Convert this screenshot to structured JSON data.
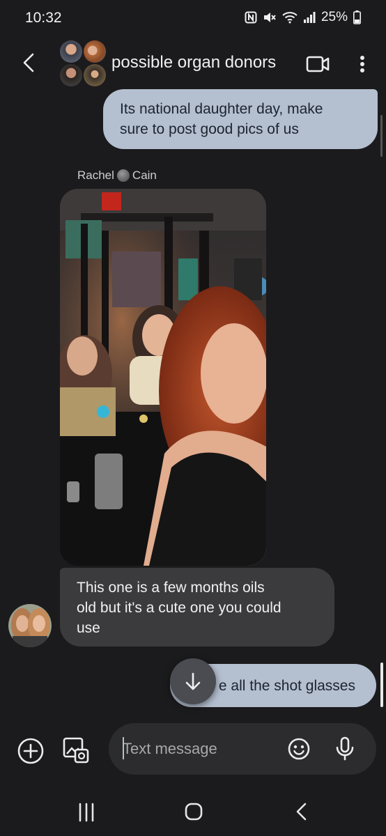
{
  "status_bar": {
    "time": "10:32",
    "battery": "25%",
    "icons": [
      "nfc-icon",
      "mute-icon",
      "wifi-icon",
      "signal-icon",
      "battery-icon"
    ]
  },
  "header": {
    "title": "possible organ donors",
    "back_icon": "back-arrow-icon",
    "video_icon": "video-call-icon",
    "more_icon": "more-vert-icon"
  },
  "messages": [
    {
      "direction": "outgoing",
      "text_lines": [
        "Its national daughter day, make",
        "sure to post good pics of us"
      ]
    },
    {
      "direction": "incoming",
      "sender": {
        "first": "Rachel",
        "last": "Cain"
      },
      "type": "image"
    },
    {
      "direction": "incoming",
      "text_lines": [
        "This one is a few months oils",
        "old but it's a cute one you could",
        "use"
      ]
    },
    {
      "direction": "outgoing",
      "text": "e all the shot glasses"
    }
  ],
  "composer": {
    "placeholder": "Text message",
    "add_icon": "add-circle-icon",
    "gallery_icon": "gallery-icon",
    "emoji_icon": "emoji-icon",
    "mic_icon": "mic-icon"
  },
  "colors": {
    "background": "#1b1b1d",
    "outgoing_bubble": "#b4bfd0",
    "incoming_bubble": "#3b3b3e"
  },
  "nav": [
    "recents-icon",
    "home-icon",
    "back-nav-icon"
  ]
}
